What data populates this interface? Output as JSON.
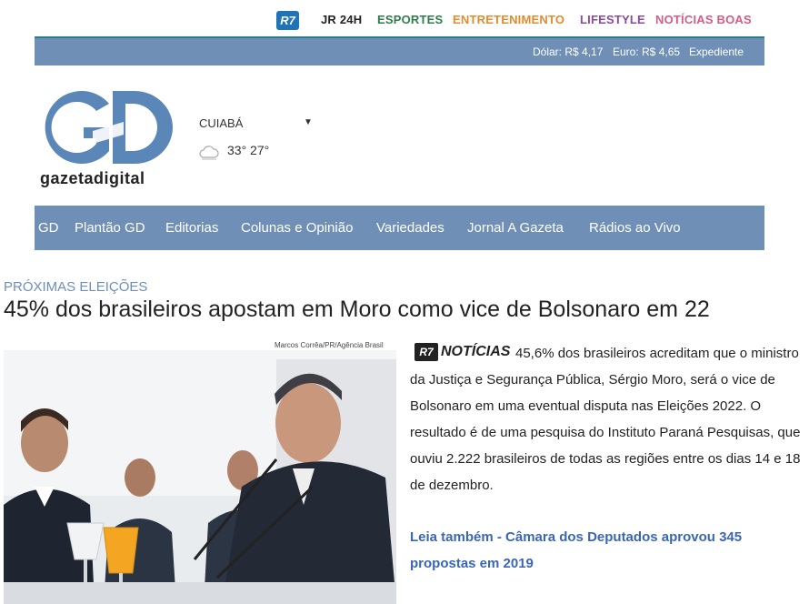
{
  "portal_nav": {
    "logo": "R7",
    "links": [
      "JR 24H",
      "ESPORTES",
      "ENTRETENIMENTO",
      "LIFESTYLE",
      "NOTÍCIAS BOAS"
    ]
  },
  "currency_bar": {
    "dolar": "Dólar: R$ 4,17",
    "euro": "Euro: R$ 4,65",
    "expediente": "Expediente"
  },
  "site": {
    "logo_letters": "GD",
    "logo_word": "gazetadigital"
  },
  "weather": {
    "city": "CUIABÁ",
    "temps": "33°  27°",
    "icon": "cloud-icon"
  },
  "main_nav": [
    "GD",
    "Plantão GD",
    "Editorias",
    "Colunas e Opinião",
    "Variedades",
    "Jornal A Gazeta",
    "Rádios ao Vivo"
  ],
  "article": {
    "kicker": "PRÓXIMAS ELEIÇÕES",
    "headline": "45% dos brasileiros apostam em Moro como vice de Bolsonaro em 22",
    "photo_credit": "Marcos Corrêa/PR/Agência Brasil",
    "source_badge": "R7",
    "source_word": "NOTÍCIAS",
    "body": "45,6% dos brasileiros acreditam que o ministro da Justiça e Segurança Pública, Sérgio Moro, será o vice de Bolsonaro em uma eventual disputa nas Eleições 2022. O resultado é de uma pesquisa do Instituto Paraná Pesquisas, que ouviu 2.222 brasileiros de todas as regiões entre os dias 14 e 18 de dezembro.",
    "read_more": "Leia também - Câmara dos Deputados aprovou 345 propostas em 2019"
  },
  "colors": {
    "nav_blue": "#6f8fb7",
    "link_blue": "#3a66b8",
    "logo_blue": "#5b86b8"
  }
}
